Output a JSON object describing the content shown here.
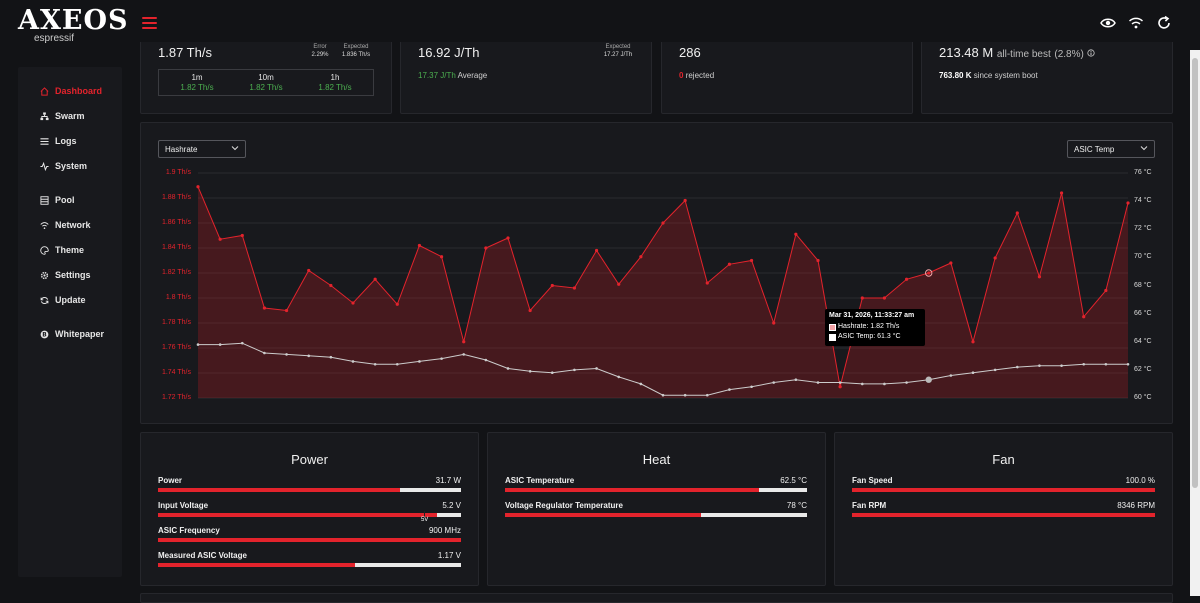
{
  "app": {
    "logo": "AXEOS",
    "logo_sub": "espressif"
  },
  "nav": {
    "items": [
      {
        "label": "Dashboard",
        "icon": "home-icon",
        "active": true
      },
      {
        "label": "Swarm",
        "icon": "sitemap-icon",
        "active": false
      },
      {
        "label": "Logs",
        "icon": "list-icon",
        "active": false
      },
      {
        "label": "System",
        "icon": "pulse-icon",
        "active": false
      },
      {
        "label": "Pool",
        "icon": "server-icon",
        "active": false
      },
      {
        "label": "Network",
        "icon": "wifi-icon",
        "active": false
      },
      {
        "label": "Theme",
        "icon": "palette-icon",
        "active": false
      },
      {
        "label": "Settings",
        "icon": "gear-icon",
        "active": false
      },
      {
        "label": "Update",
        "icon": "refresh-icon",
        "active": false
      },
      {
        "label": "Whitepaper",
        "icon": "bitcoin-icon",
        "active": false
      }
    ]
  },
  "stats": {
    "hashrate": {
      "value": "1.87 Th/s",
      "error_label": "Error",
      "error_value": "2.29%",
      "expected_label": "Expected",
      "expected_value": "1.836 Th/s",
      "averages": [
        {
          "label": "1m",
          "value": "1.82 Th/s"
        },
        {
          "label": "10m",
          "value": "1.82 Th/s"
        },
        {
          "label": "1h",
          "value": "1.82 Th/s"
        }
      ]
    },
    "efficiency": {
      "value": "16.92 J/Th",
      "expected_label": "Expected",
      "expected_value": "17.27 J/Th",
      "average_value": "17.37 J/Th",
      "average_label": "Average"
    },
    "shares": {
      "value": "286",
      "rejected_count": "0",
      "rejected_label": "rejected"
    },
    "best": {
      "value": "213.48 M",
      "label": "all-time best",
      "percent": "(2.8%)",
      "since_value": "763.80 K",
      "since_label": "since system boot"
    }
  },
  "chart_controls": {
    "left_select": "Hashrate",
    "right_select": "ASIC Temp"
  },
  "chart_data": {
    "type": "line",
    "y_left_ticks": [
      "1.9 Th/s",
      "1.88 Th/s",
      "1.86 Th/s",
      "1.84 Th/s",
      "1.82 Th/s",
      "1.8 Th/s",
      "1.78 Th/s",
      "1.76 Th/s",
      "1.74 Th/s",
      "1.72 Th/s"
    ],
    "y_right_ticks": [
      "76 °C",
      "74 °C",
      "72 °C",
      "70 °C",
      "68 °C",
      "66 °C",
      "64 °C",
      "62 °C",
      "60 °C"
    ],
    "ylim_left": [
      1.72,
      1.9
    ],
    "ylim_right": [
      60,
      76
    ],
    "series": [
      {
        "name": "Hashrate",
        "color": "#e3232c",
        "values": [
          1.889,
          1.847,
          1.85,
          1.792,
          1.79,
          1.822,
          1.81,
          1.796,
          1.815,
          1.795,
          1.842,
          1.833,
          1.765,
          1.84,
          1.848,
          1.79,
          1.81,
          1.808,
          1.838,
          1.811,
          1.833,
          1.86,
          1.878,
          1.812,
          1.827,
          1.83,
          1.78,
          1.851,
          1.83,
          1.729,
          1.8,
          1.8,
          1.815,
          1.82,
          1.828,
          1.765,
          1.832,
          1.868,
          1.817,
          1.884,
          1.785,
          1.806,
          1.876
        ]
      },
      {
        "name": "ASIC Temp",
        "color": "#cccccc",
        "values": [
          63.8,
          63.8,
          63.9,
          63.2,
          63.1,
          63.0,
          62.9,
          62.6,
          62.4,
          62.4,
          62.6,
          62.8,
          63.1,
          62.7,
          62.1,
          61.9,
          61.8,
          62.0,
          62.1,
          61.5,
          61.0,
          60.2,
          60.2,
          60.2,
          60.6,
          60.8,
          61.1,
          61.3,
          61.1,
          61.1,
          61.0,
          61.0,
          61.1,
          61.3,
          61.6,
          61.8,
          62.0,
          62.2,
          62.3,
          62.3,
          62.4,
          62.4,
          62.4
        ]
      }
    ],
    "tooltip": {
      "index": 33,
      "timestamp": "Mar 31, 2026, 11:33:27 am",
      "hashrate_line": "Hashrate: 1.82 Th/s",
      "temp_line": "ASIC Temp: 61.3 °C"
    }
  },
  "panels": {
    "power": {
      "title": "Power",
      "metrics": [
        {
          "label": "Power",
          "value": "31.7 W",
          "fill": 0.8
        },
        {
          "label": "Input Voltage",
          "value": "5.2 V",
          "fill": 0.92,
          "marker": "5V"
        },
        {
          "label": "ASIC Frequency",
          "value": "900 MHz",
          "fill": 1.0
        },
        {
          "label": "Measured ASIC Voltage",
          "value": "1.17 V",
          "fill": 0.65
        }
      ]
    },
    "heat": {
      "title": "Heat",
      "metrics": [
        {
          "label": "ASIC Temperature",
          "value": "62.5 °C",
          "fill": 0.84
        },
        {
          "label": "Voltage Regulator Temperature",
          "value": "78 °C",
          "fill": 0.65
        }
      ]
    },
    "fan": {
      "title": "Fan",
      "metrics": [
        {
          "label": "Fan Speed",
          "value": "100.0 %",
          "fill": 1.0
        },
        {
          "label": "Fan RPM",
          "value": "8346 RPM",
          "fill": 1.0
        }
      ]
    }
  }
}
